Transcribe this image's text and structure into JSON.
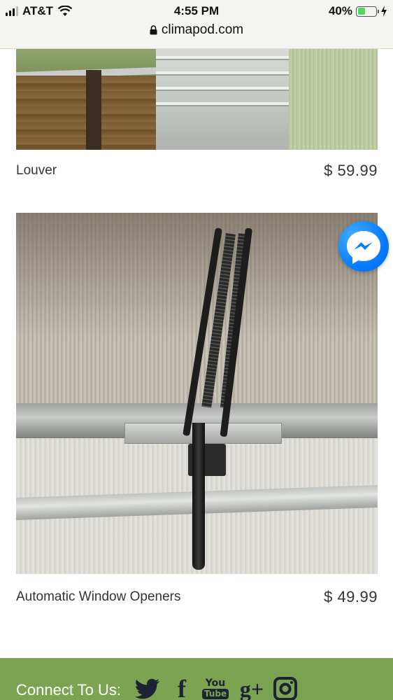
{
  "status_bar": {
    "carrier": "AT&T",
    "time": "4:55 PM",
    "battery_percent": "40%",
    "battery_level": 0.4
  },
  "url_bar": {
    "domain": "climapod.com"
  },
  "products": [
    {
      "name": "Louver",
      "price": "$ 59.99"
    },
    {
      "name": "Automatic Window Openers",
      "price": "$ 49.99"
    }
  ],
  "footer": {
    "connect_label": "Connect To Us:",
    "social": {
      "twitter": "twitter-icon",
      "facebook": "f",
      "youtube_top": "You",
      "youtube_bottom": "Tube",
      "googleplus": "g+",
      "instagram": "instagram-icon"
    },
    "color": "#7ba351"
  },
  "colors": {
    "accent_green": "#7ba351",
    "messenger_blue": "#0a7cff",
    "battery_green": "#4cd964"
  }
}
